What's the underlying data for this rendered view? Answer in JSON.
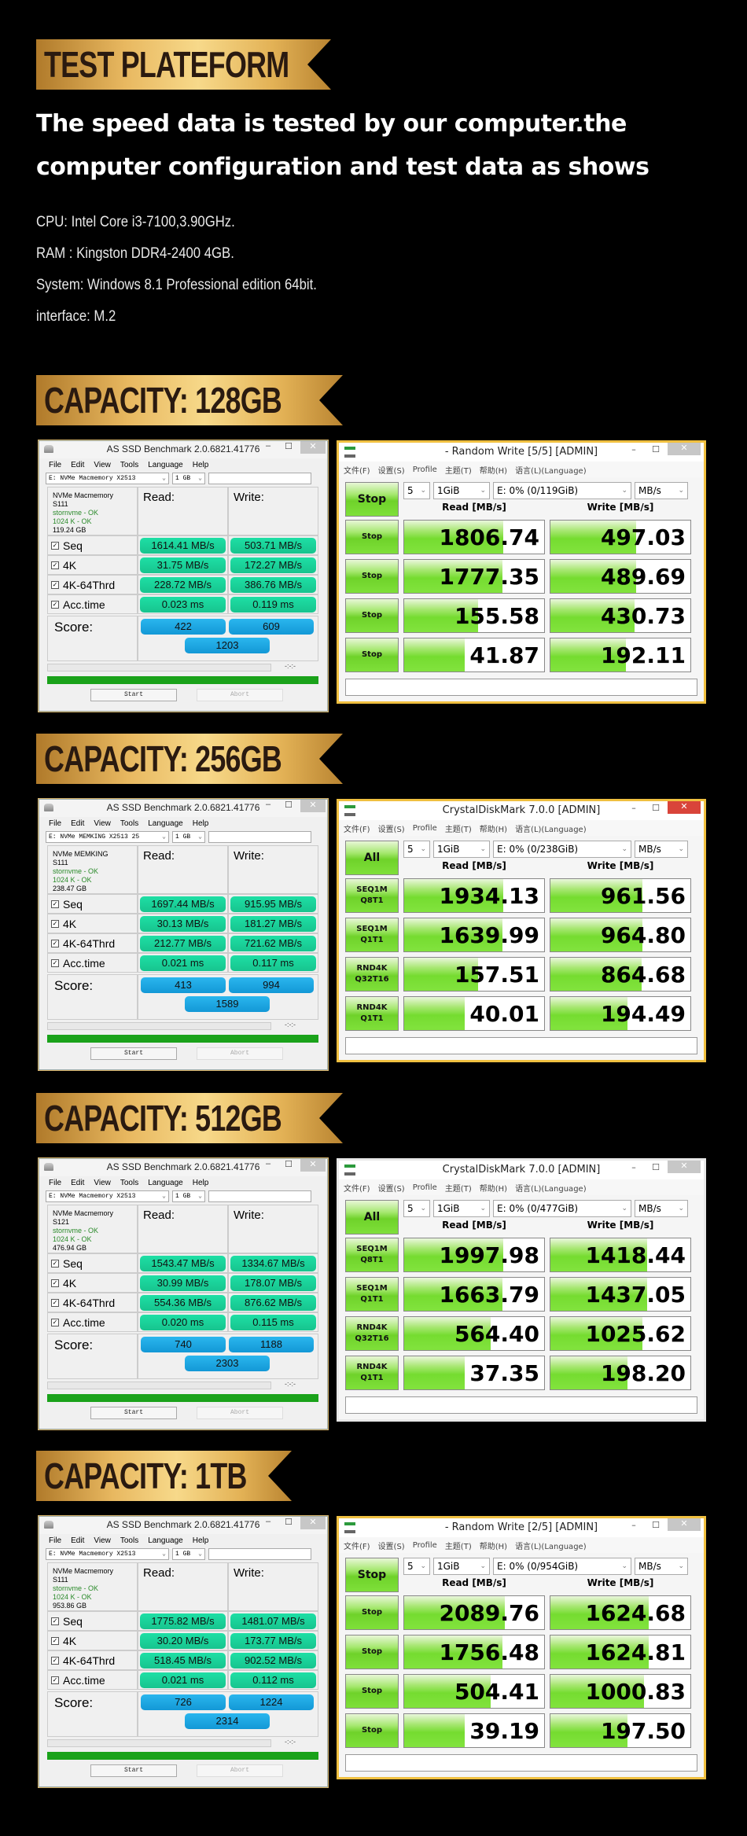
{
  "test_platform": {
    "banner": "TEST PLATEFORM",
    "headline_1": "The speed data is tested by our computer.the",
    "headline_2": "computer configuration and test data as shows",
    "specs": [
      "CPU:   Intel Core i3-7100,3.90GHz.",
      "RAM : Kingston DDR4-2400 4GB.",
      "System: Windows 8.1 Professional edition 64bit.",
      "interface:  M.2"
    ]
  },
  "common": {
    "asssd_title": "AS SSD Benchmark 2.0.6821.41776",
    "asssd_menu": [
      "File",
      "Edit",
      "View",
      "Tools",
      "Language",
      "Help"
    ],
    "asssd_size": "1 GB",
    "read_label": "Read:",
    "write_label": "Write:",
    "row_labels": [
      "Seq",
      "4K",
      "4K-64Thrd",
      "Acc.time"
    ],
    "score_label": "Score:",
    "time_placeholder": "-:-:-",
    "start": "Start",
    "abort": "Abort",
    "cdm_menu": [
      "文件(F)",
      "设置(S)",
      "Profile",
      "主题(T)",
      "帮助(H)",
      "语言(L)(Language)"
    ],
    "cdm_count": "5",
    "cdm_size": "1GiB",
    "cdm_unit": "MB/s",
    "cdm_read_hdr": "Read [MB/s]",
    "cdm_write_hdr": "Write [MB/s]",
    "chevron": "⌄",
    "minimize": "–",
    "maximize": "☐",
    "close": "✕",
    "check": "✓"
  },
  "sections": [
    {
      "banner": "CAPACITY: 128GB",
      "asssd": {
        "drive": "E: NVMe Macmemory X2513",
        "model": "NVMe Macmemory",
        "fw": "S111",
        "driver": "stornvme - OK",
        "align": "1024 K - OK",
        "capacity": "119.24 GB",
        "read": [
          "1614.41 MB/s",
          "31.75 MB/s",
          "228.72 MB/s",
          "0.023 ms"
        ],
        "write": [
          "503.71 MB/s",
          "172.27 MB/s",
          "386.76 MB/s",
          "0.119 ms"
        ],
        "score_read": "422",
        "score_write": "609",
        "score_total": "1203"
      },
      "cdm": {
        "title": "- Random Write [5/5] [ADMIN]",
        "drive": "E: 0% (0/119GiB)",
        "top_button": "Stop",
        "row_buttons": [
          [
            "Stop"
          ],
          [
            "Stop"
          ],
          [
            "Stop"
          ],
          [
            "Stop"
          ]
        ],
        "read": [
          "1806.74",
          "1777.35",
          "155.58",
          "41.87"
        ],
        "write": [
          "497.03",
          "489.69",
          "430.73",
          "192.11"
        ],
        "read_fill": [
          0.71,
          0.7,
          0.53,
          0.43
        ],
        "write_fill": [
          0.61,
          0.61,
          0.6,
          0.54
        ]
      }
    },
    {
      "banner": "CAPACITY: 256GB",
      "asssd": {
        "drive": "E: NVMe MEMKING X2513 25",
        "model": "NVMe MEMKING",
        "fw": "S111",
        "driver": "stornvme - OK",
        "align": "1024 K - OK",
        "capacity": "238.47 GB",
        "read": [
          "1697.44 MB/s",
          "30.13 MB/s",
          "212.77 MB/s",
          "0.021 ms"
        ],
        "write": [
          "915.95 MB/s",
          "181.27 MB/s",
          "721.62 MB/s",
          "0.117 ms"
        ],
        "score_read": "413",
        "score_write": "994",
        "score_total": "1589"
      },
      "cdm": {
        "title": "CrystalDiskMark 7.0.0  [ADMIN]",
        "drive": "E: 0% (0/238GiB)",
        "top_button": "All",
        "row_buttons": [
          [
            "SEQ1M",
            "Q8T1"
          ],
          [
            "SEQ1M",
            "Q1T1"
          ],
          [
            "RND4K",
            "Q32T16"
          ],
          [
            "RND4K",
            "Q1T1"
          ]
        ],
        "read": [
          "1934.13",
          "1639.99",
          "157.51",
          "40.01"
        ],
        "write": [
          "961.56",
          "964.80",
          "864.68",
          "194.49"
        ],
        "read_fill": [
          0.71,
          0.7,
          0.53,
          0.43
        ],
        "write_fill": [
          0.66,
          0.66,
          0.65,
          0.55
        ]
      }
    },
    {
      "banner": "CAPACITY: 512GB",
      "asssd": {
        "drive": "E: NVMe Macmemory X2513",
        "model": "NVMe Macmemory",
        "fw": "S121",
        "driver": "stornvme - OK",
        "align": "1024 K - OK",
        "capacity": "476.94 GB",
        "read": [
          "1543.47 MB/s",
          "30.99 MB/s",
          "554.36 MB/s",
          "0.020 ms"
        ],
        "write": [
          "1334.67 MB/s",
          "178.07 MB/s",
          "876.62 MB/s",
          "0.115 ms"
        ],
        "score_read": "740",
        "score_write": "1188",
        "score_total": "2303"
      },
      "cdm": {
        "title": "CrystalDiskMark 7.0.0  [ADMIN]",
        "drive": "E: 0% (0/477GiB)",
        "top_button": "All",
        "row_buttons": [
          [
            "SEQ1M",
            "Q8T1"
          ],
          [
            "SEQ1M",
            "Q1T1"
          ],
          [
            "RND4K",
            "Q32T16"
          ],
          [
            "RND4K",
            "Q1T1"
          ]
        ],
        "read": [
          "1997.98",
          "1663.79",
          "564.40",
          "37.35"
        ],
        "write": [
          "1418.44",
          "1437.05",
          "1025.62",
          "198.20"
        ],
        "read_fill": [
          0.71,
          0.7,
          0.62,
          0.43
        ],
        "write_fill": [
          0.69,
          0.69,
          0.66,
          0.55
        ]
      }
    },
    {
      "banner": "CAPACITY: 1TB",
      "asssd": {
        "drive": "E: NVMe Macmemory X2513",
        "model": "NVMe Macmemory",
        "fw": "S111",
        "driver": "stornvme - OK",
        "align": "1024 K - OK",
        "capacity": "953.86 GB",
        "read": [
          "1775.82 MB/s",
          "30.20 MB/s",
          "518.45 MB/s",
          "0.021 ms"
        ],
        "write": [
          "1481.07 MB/s",
          "173.77 MB/s",
          "902.52 MB/s",
          "0.112 ms"
        ],
        "score_read": "726",
        "score_write": "1224",
        "score_total": "2314"
      },
      "cdm": {
        "title": "- Random Write [2/5] [ADMIN]",
        "drive": "E: 0% (0/954GiB)",
        "top_button": "Stop",
        "row_buttons": [
          [
            "Stop"
          ],
          [
            "Stop"
          ],
          [
            "Stop"
          ],
          [
            "Stop"
          ]
        ],
        "read": [
          "2089.76",
          "1756.48",
          "504.41",
          "39.19"
        ],
        "write": [
          "1624.68",
          "1624.81",
          "1000.83",
          "197.50"
        ],
        "read_fill": [
          0.72,
          0.7,
          0.62,
          0.43
        ],
        "write_fill": [
          0.7,
          0.7,
          0.67,
          0.55
        ]
      }
    }
  ]
}
